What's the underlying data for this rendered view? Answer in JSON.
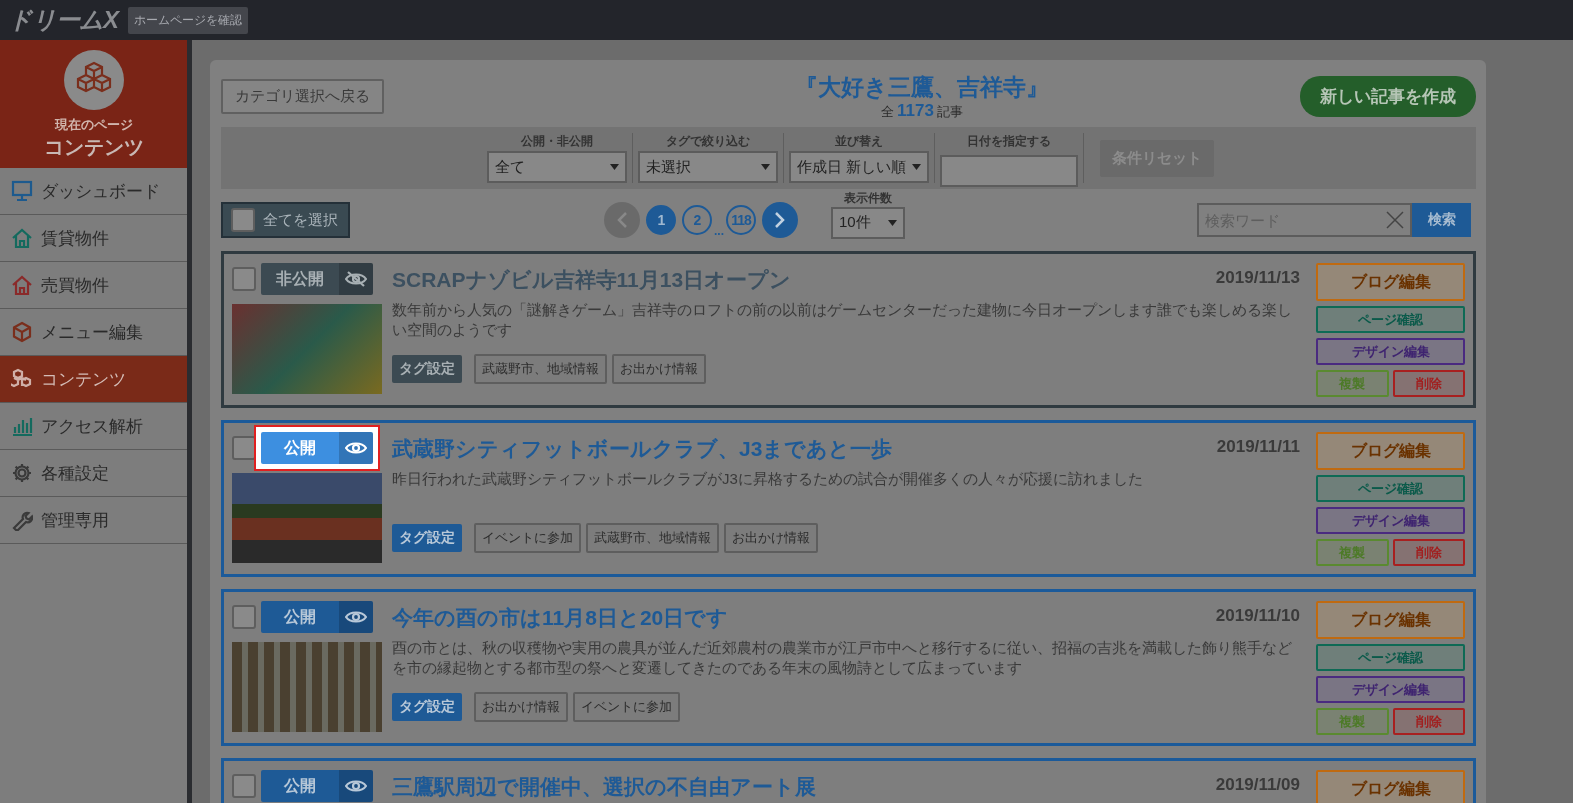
{
  "header": {
    "logo": "ドリームX",
    "home_button": "ホームページを確認"
  },
  "sidebar": {
    "current_label": "現在のページ",
    "current_title": "コンテンツ",
    "items": [
      {
        "label": "ダッシュボード",
        "kind": "monitor",
        "color": "#1d5a8e",
        "selected": false
      },
      {
        "label": "賃貸物件",
        "kind": "house",
        "color": "#146a5e",
        "selected": false
      },
      {
        "label": "売買物件",
        "kind": "house",
        "color": "#8a2a2a",
        "selected": false
      },
      {
        "label": "メニュー編集",
        "kind": "cube",
        "color": "#7a2e1c",
        "selected": false
      },
      {
        "label": "コンテンツ",
        "kind": "cubes",
        "color": "#d0b0a8",
        "selected": true
      },
      {
        "label": "アクセス解析",
        "kind": "chart",
        "color": "#146a5e",
        "selected": false
      },
      {
        "label": "各種設定",
        "kind": "gear",
        "color": "#3a3a3a",
        "selected": false
      },
      {
        "label": "管理専用",
        "kind": "wrench",
        "color": "#3a3a3a",
        "selected": false
      }
    ]
  },
  "toolbar": {
    "back_button": "カテゴリ選択へ戻る",
    "title": "『大好き三鷹、吉祥寺』",
    "count_prefix": "全",
    "count": "1173",
    "count_suffix": "記事",
    "new_button": "新しい記事を作成"
  },
  "filters": [
    {
      "label": "公開・非公開",
      "kind": "select",
      "value": "全て"
    },
    {
      "label": "タグで絞り込む",
      "kind": "select",
      "value": "未選択"
    },
    {
      "label": "並び替え",
      "kind": "select",
      "value": "作成日 新しい順"
    },
    {
      "label": "日付を指定する",
      "kind": "date"
    }
  ],
  "reset_button": {
    "label": "条件リセット",
    "disabled": true
  },
  "select_all": {
    "label": "全てを選択",
    "checked": false
  },
  "pagination": {
    "prev_disabled": true,
    "next_disabled": false,
    "items": [
      {
        "kind": "page",
        "label": "1",
        "selected": true
      },
      {
        "kind": "page",
        "label": "2",
        "selected": false
      },
      {
        "kind": "ellipsis",
        "label": "..."
      },
      {
        "kind": "page",
        "label": "118",
        "selected": false
      }
    ]
  },
  "per_page": {
    "label": "表示件数",
    "value": "10件"
  },
  "search": {
    "placeholder": "検索ワード",
    "button": "検索"
  },
  "articles": [
    {
      "status": "非公開",
      "published": false,
      "highlighted": false,
      "checked": false,
      "title": "SCRAPナゾビル吉祥寺11月13日オープン",
      "date": "2019/11/13",
      "description": "数年前から人気の「謎解きゲーム」吉祥寺のロフトの前の以前はゲームセンターだった建物に今日オープンします誰でも楽しめる楽しい空間のようです",
      "tag_button": "タグ設定",
      "tags": [
        "武蔵野市、地域情報",
        "お出かけ情報"
      ],
      "actions": [
        {
          "kind": "blog",
          "label": "ブログ編集"
        },
        {
          "kind": "page",
          "label": "ページ確認"
        },
        {
          "kind": "design",
          "label": "デザイン編集"
        },
        {
          "kind": "copy",
          "label": "複製"
        },
        {
          "kind": "delete",
          "label": "削除"
        }
      ]
    },
    {
      "status": "公開",
      "published": true,
      "highlighted": true,
      "checked": false,
      "title": "武蔵野シティフットボールクラブ、J3まであと一歩",
      "date": "2019/11/11",
      "description": "昨日行われた武蔵野シティフットボールクラブがJ3に昇格するための試合が開催多くの人々が応援に訪れました",
      "tag_button": "タグ設定",
      "tags": [
        "イベントに参加",
        "武蔵野市、地域情報",
        "お出かけ情報"
      ],
      "actions": [
        {
          "kind": "blog",
          "label": "ブログ編集"
        },
        {
          "kind": "page",
          "label": "ページ確認"
        },
        {
          "kind": "design",
          "label": "デザイン編集"
        },
        {
          "kind": "copy",
          "label": "複製"
        },
        {
          "kind": "delete",
          "label": "削除"
        }
      ]
    },
    {
      "status": "公開",
      "published": true,
      "highlighted": false,
      "checked": false,
      "title": "今年の酉の市は11月8日と20日です",
      "date": "2019/11/10",
      "description": "酉の市とは、秋の収穫物や実用の農具が並んだ近郊農村の農業市が江戸市中へと移行するに従い、招福の吉兆を満載した飾り熊手などを市の縁起物とする都市型の祭へと変遷してきたのである年末の風物詩として広まっています",
      "tag_button": "タグ設定",
      "tags": [
        "お出かけ情報",
        "イベントに参加"
      ],
      "actions": [
        {
          "kind": "blog",
          "label": "ブログ編集"
        },
        {
          "kind": "page",
          "label": "ページ確認"
        },
        {
          "kind": "design",
          "label": "デザイン編集"
        },
        {
          "kind": "copy",
          "label": "複製"
        },
        {
          "kind": "delete",
          "label": "削除"
        }
      ]
    },
    {
      "status": "公開",
      "published": true,
      "highlighted": false,
      "checked": false,
      "title": "三鷹駅周辺で開催中、選択の不自由アート展",
      "date": "2019/11/09",
      "actions": [
        {
          "kind": "blog",
          "label": "ブログ編集"
        }
      ]
    }
  ]
}
